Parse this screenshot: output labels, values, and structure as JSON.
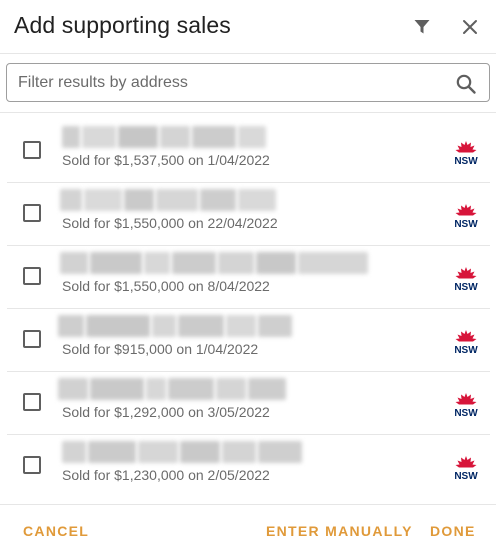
{
  "dialog": {
    "title": "Add supporting sales",
    "filter_icon": "filter-icon",
    "close_icon": "close-icon"
  },
  "search": {
    "placeholder": "Filter results by address",
    "value": "",
    "icon": "search-icon"
  },
  "sales": [
    {
      "address": "(redacted)",
      "sold": "Sold for $1,537,500 on 1/04/2022",
      "badge": "NSW"
    },
    {
      "address": "(redacted)",
      "sold": "Sold for $1,550,000 on 22/04/2022",
      "badge": "NSW"
    },
    {
      "address": "(redacted)",
      "sold": "Sold for $1,550,000 on 8/04/2022",
      "badge": "NSW"
    },
    {
      "address": "(redacted)",
      "sold": "Sold for $915,000 on 1/04/2022",
      "badge": "NSW"
    },
    {
      "address": "(redacted)",
      "sold": "Sold for $1,292,000 on 3/05/2022",
      "badge": "NSW"
    },
    {
      "address": "(redacted)",
      "sold": "Sold for $1,230,000 on 2/05/2022",
      "badge": "NSW"
    }
  ],
  "footer": {
    "cancel_label": "CANCEL",
    "manual_label": "ENTER MANUALLY",
    "done_label": "DONE"
  },
  "colors": {
    "accent": "#e09a3a",
    "nsw_red": "#d7153a",
    "nsw_navy": "#002664",
    "muted_text": "#6b6b6b"
  }
}
